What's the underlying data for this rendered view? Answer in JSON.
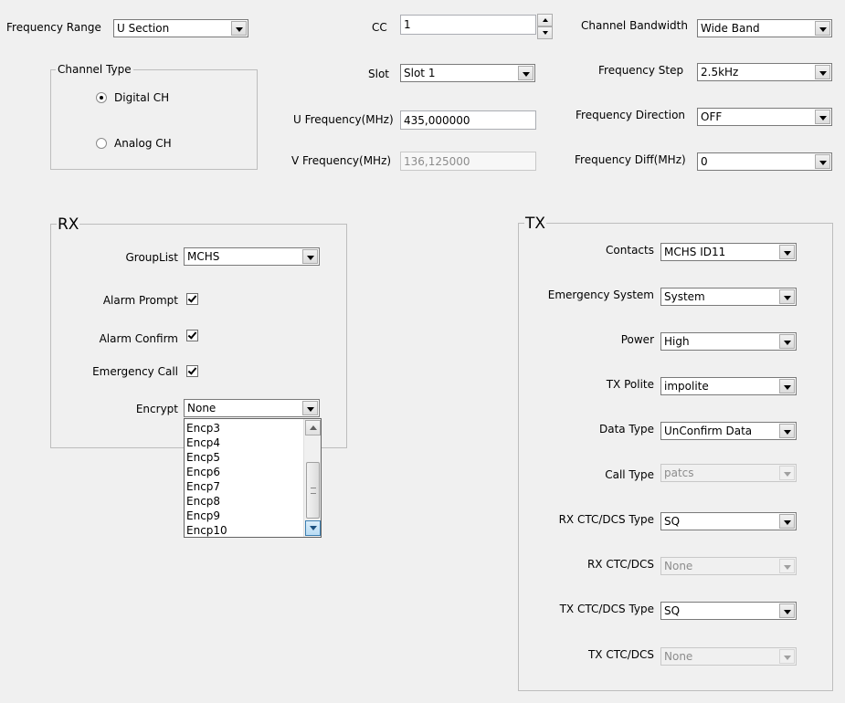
{
  "top": {
    "frequency_range": {
      "label": "Frequency Range",
      "value": "U Section"
    },
    "cc": {
      "label": "CC",
      "value": "1"
    },
    "channel_bandwidth": {
      "label": "Channel Bandwidth",
      "value": "Wide Band"
    },
    "slot": {
      "label": "Slot",
      "value": "Slot 1"
    },
    "frequency_step": {
      "label": "Frequency Step",
      "value": "2.5kHz"
    },
    "u_frequency": {
      "label": "U Frequency(MHz)",
      "value": "435,000000"
    },
    "frequency_direction": {
      "label": "Frequency Direction",
      "value": "OFF"
    },
    "v_frequency": {
      "label": "V Frequency(MHz)",
      "value": "136,125000"
    },
    "frequency_diff": {
      "label": "Frequency Diff(MHz)",
      "value": "0"
    }
  },
  "channel_type": {
    "title": "Channel Type",
    "options": [
      {
        "label": "Digital CH",
        "selected": true
      },
      {
        "label": "Analog CH",
        "selected": false
      }
    ]
  },
  "rx": {
    "title": "RX",
    "group_list": {
      "label": "GroupList",
      "value": "MCHS"
    },
    "alarm_prompt": {
      "label": "Alarm Prompt",
      "checked": true
    },
    "alarm_confirm": {
      "label": "Alarm Confirm",
      "checked": true
    },
    "emergency_call": {
      "label": "Emergency Call",
      "checked": true
    },
    "encrypt": {
      "label": "Encrypt",
      "value": "None",
      "dropdown_open": true,
      "visible_options": [
        "Encp3",
        "Encp4",
        "Encp5",
        "Encp6",
        "Encp7",
        "Encp8",
        "Encp9",
        "Encp10"
      ]
    }
  },
  "tx": {
    "title": "TX",
    "contacts": {
      "label": "Contacts",
      "value": "MCHS ID11",
      "enabled": true
    },
    "emergency_system": {
      "label": "Emergency System",
      "value": "System",
      "enabled": true
    },
    "power": {
      "label": "Power",
      "value": "High",
      "enabled": true
    },
    "tx_polite": {
      "label": "TX Polite",
      "value": "impolite",
      "enabled": true
    },
    "data_type": {
      "label": "Data Type",
      "value": "UnConfirm Data",
      "enabled": true
    },
    "call_type": {
      "label": "Call Type",
      "value": "patcs",
      "enabled": false
    },
    "rx_ctcdcs_type": {
      "label": "RX CTC/DCS Type",
      "value": "SQ",
      "enabled": true
    },
    "rx_ctcdcs": {
      "label": "RX CTC/DCS",
      "value": "None",
      "enabled": false
    },
    "tx_ctcdcs_type": {
      "label": "TX CTC/DCS Type",
      "value": "SQ",
      "enabled": true
    },
    "tx_ctcdcs": {
      "label": "TX CTC/DCS",
      "value": "None",
      "enabled": false
    }
  }
}
